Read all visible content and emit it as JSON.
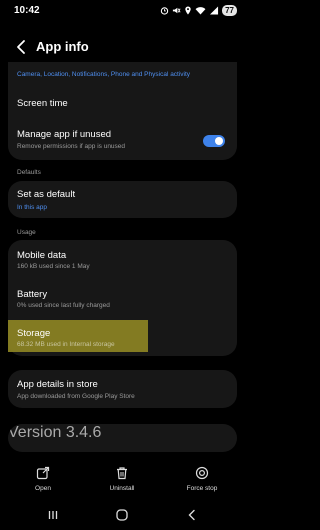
{
  "status_bar": {
    "time": "10:42",
    "battery": "77",
    "icons": [
      "alarm-icon",
      "mute-icon",
      "location-icon",
      "wifi-icon",
      "signal-icon",
      "battery-icon"
    ]
  },
  "header": {
    "title": "App info",
    "back_icon": "back-arrow-icon"
  },
  "permissions": {
    "summary": "Camera, Location, Notifications, Phone and Physical activity"
  },
  "screen_time": {
    "label": "Screen time"
  },
  "manage": {
    "label": "Manage app if unused",
    "sub": "Remove permissions if app is unused",
    "toggle_on": true,
    "toggle_color": "#3e82ea"
  },
  "defaults": {
    "section": "Defaults",
    "label": "Set as default",
    "sub": "In this app",
    "sub_color": "#4f8ff0"
  },
  "usage": {
    "section": "Usage",
    "mobile_data": {
      "label": "Mobile data",
      "sub": "160 kB used since 1 May"
    },
    "battery": {
      "label": "Battery",
      "sub": "0% used since last fully charged"
    },
    "storage": {
      "label": "Storage",
      "sub": "68.32 MB used in Internal storage"
    }
  },
  "store": {
    "label": "App details in store",
    "sub": "App downloaded from Google Play Store"
  },
  "version": {
    "text": "Version 3.4.6"
  },
  "actions": {
    "open": "Open",
    "uninstall": "Uninstall",
    "force_stop": "Force stop"
  },
  "colors": {
    "background": "#000000",
    "card": "#171717",
    "highlight": "#8f8623"
  }
}
